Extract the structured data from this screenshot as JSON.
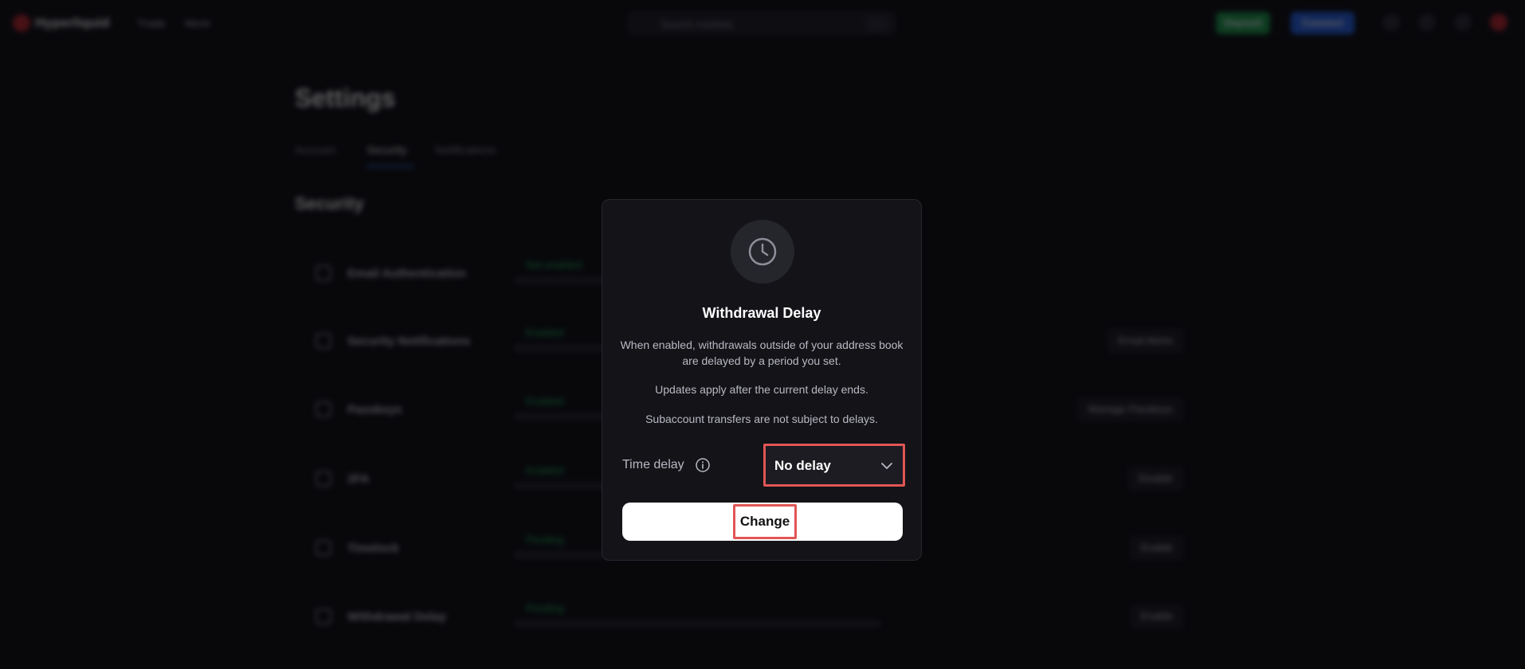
{
  "app": {
    "logo_text": "Hyperliquid"
  },
  "topbar": {
    "nav": [
      "Trade",
      "More"
    ],
    "search_placeholder": "Search markets",
    "buttons": [
      {
        "label": "Deposit",
        "color": "#1a9d4a"
      },
      {
        "label": "Connect",
        "color": "#2563eb"
      }
    ]
  },
  "page": {
    "title": "Settings",
    "tabs": [
      "Account",
      "Security",
      "Notifications"
    ],
    "active_tab": "Security",
    "section_title": "Security",
    "rows": [
      {
        "label": "Email Authentication",
        "status": "Not enabled",
        "action": ""
      },
      {
        "label": "Security Notifications",
        "status": "Enabled",
        "action": "Email Alerts"
      },
      {
        "label": "Passkeys",
        "status": "Enabled",
        "action": "Manage Passkeys"
      },
      {
        "label": "2FA",
        "status": "Enabled",
        "action": "Disable"
      },
      {
        "label": "Timelock",
        "status": "Pending",
        "action": "Enable"
      },
      {
        "label": "Withdrawal Delay",
        "status": "Pending",
        "action": "Enable"
      }
    ]
  },
  "modal": {
    "icon": "clock-icon",
    "title": "Withdrawal Delay",
    "desc1": "When enabled, withdrawals outside of your address book are delayed by a period you set.",
    "desc2": "Updates apply after the current delay ends.",
    "desc3": "Subaccount transfers are not subject to delays.",
    "time_delay_label": "Time delay",
    "time_delay_value": "No delay",
    "change_button": "Change"
  },
  "colors": {
    "accent_highlight": "#e25555",
    "modal_bg": "#131318",
    "page_bg": "#0b0b0f"
  }
}
